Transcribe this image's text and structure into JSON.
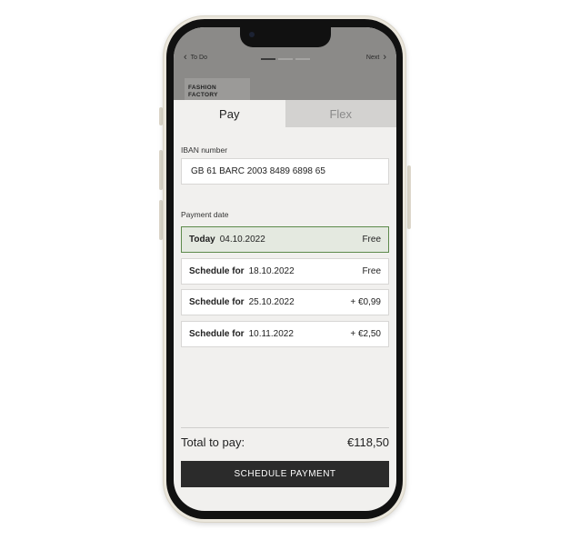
{
  "header": {
    "back_label": "To Do",
    "next_label": "Next",
    "logo_line1": "FASHION",
    "logo_line2": "FACTORY",
    "progress": {
      "steps": 3,
      "current": 1
    }
  },
  "tabs": [
    {
      "label": "Pay",
      "active": true
    },
    {
      "label": "Flex",
      "active": false
    }
  ],
  "iban": {
    "label": "IBAN number",
    "value": "GB 61 BARC 2003 8489 6898 65"
  },
  "payment_date": {
    "label": "Payment date",
    "options": [
      {
        "label": "Today",
        "date": "04.10.2022",
        "price": "Free",
        "selected": true
      },
      {
        "label": "Schedule for",
        "date": "18.10.2022",
        "price": "Free",
        "selected": false
      },
      {
        "label": "Schedule for",
        "date": "25.10.2022",
        "price": "+ €0,99",
        "selected": false
      },
      {
        "label": "Schedule for",
        "date": "10.11.2022",
        "price": "+ €2,50",
        "selected": false
      }
    ]
  },
  "total": {
    "label": "Total to pay:",
    "amount": "€118,50"
  },
  "action": {
    "button_label": "SCHEDULE PAYMENT"
  },
  "colors": {
    "accent_border": "#5d8a4b",
    "selected_bg": "#e4e9e0",
    "button_bg": "#2b2b2b",
    "screen_bg": "#f1f0ee"
  },
  "icons": {
    "back": "chevron-left-icon",
    "next": "chevron-right-icon",
    "camera": "front-camera-icon"
  }
}
